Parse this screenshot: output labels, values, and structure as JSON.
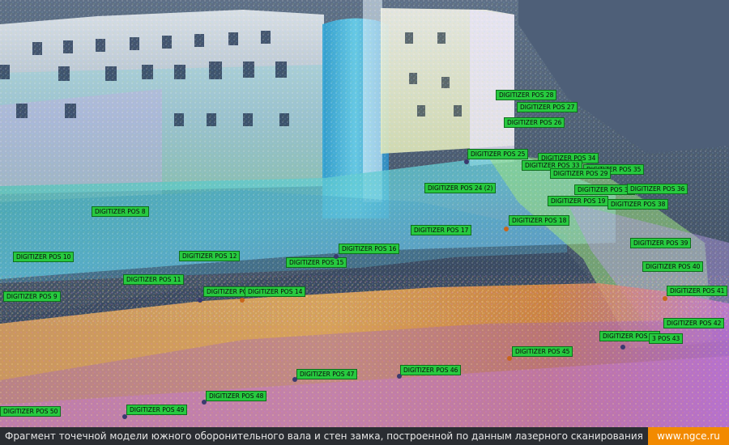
{
  "markers": [
    {
      "id": "m28",
      "label": "DIGITIZER POS 28"
    },
    {
      "id": "m27",
      "label": "DIGITIZER POS 27"
    },
    {
      "id": "m26",
      "label": "DIGITIZER POS 26"
    },
    {
      "id": "m25",
      "label": "DIGITIZER POS 25"
    },
    {
      "id": "m34",
      "label": "DIGITIZER POS 34"
    },
    {
      "id": "m33",
      "label": "DIGITIZER POS 33"
    },
    {
      "id": "m35",
      "label": "DIGITIZER POS 35"
    },
    {
      "id": "m29",
      "label": "DIGITIZER POS 29"
    },
    {
      "id": "m37",
      "label": "DIGITIZER POS 37"
    },
    {
      "id": "m36",
      "label": "DIGITIZER POS 36"
    },
    {
      "id": "m24",
      "label": "DIGITIZER POS 24 (2)"
    },
    {
      "id": "m19",
      "label": "DIGITIZER POS 19"
    },
    {
      "id": "m38",
      "label": "DIGITIZER POS 38"
    },
    {
      "id": "m8",
      "label": "DIGITIZER POS 8"
    },
    {
      "id": "m18",
      "label": "DIGITIZER POS 18"
    },
    {
      "id": "m17",
      "label": "DIGITIZER POS 17"
    },
    {
      "id": "m16",
      "label": "DIGITIZER POS 16"
    },
    {
      "id": "m39",
      "label": "DIGITIZER POS 39"
    },
    {
      "id": "m10",
      "label": "DIGITIZER POS 10"
    },
    {
      "id": "m12",
      "label": "DIGITIZER POS 12"
    },
    {
      "id": "m15",
      "label": "DIGITIZER POS 15"
    },
    {
      "id": "m40",
      "label": "DIGITIZER POS 40"
    },
    {
      "id": "m11",
      "label": "DIGITIZER POS 11"
    },
    {
      "id": "m13",
      "label": "DIGITIZER POS"
    },
    {
      "id": "m14",
      "label": "DIGITIZER POS 14"
    },
    {
      "id": "m41",
      "label": "DIGITIZER POS 41"
    },
    {
      "id": "m9",
      "label": "DIGITIZER POS 9"
    },
    {
      "id": "m42",
      "label": "DIGITIZER POS 42"
    },
    {
      "id": "m44",
      "label": "DIGITIZER POS 44"
    },
    {
      "id": "m43",
      "label": "3 POS 43"
    },
    {
      "id": "m45",
      "label": "DIGITIZER POS 45"
    },
    {
      "id": "m46",
      "label": "DIGITIZER POS 46"
    },
    {
      "id": "m47",
      "label": "DIGITIZER POS 47"
    },
    {
      "id": "m48",
      "label": "DIGITIZER POS 48"
    },
    {
      "id": "m49",
      "label": "DIGITIZER POS 49"
    },
    {
      "id": "m50",
      "label": "DIGITIZER POS 50"
    }
  ],
  "caption": "Фрагмент точечной модели южного оборонительного вала и стен замка, построенной по данным лазерного сканирования",
  "site": "www.ngce.ru",
  "colors": {
    "marker_bg": "#27c93f",
    "caption_bg": "#2a2d32",
    "site_bg": "#f28a00"
  }
}
